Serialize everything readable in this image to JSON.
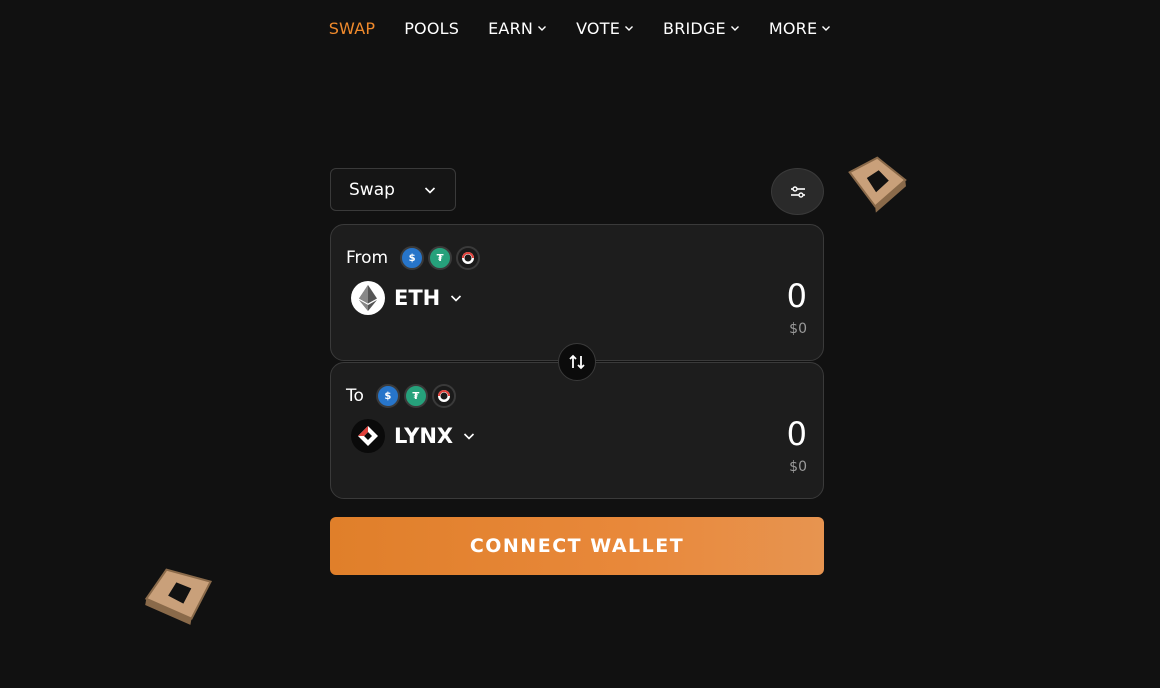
{
  "nav": {
    "items": [
      {
        "label": "SWAP",
        "active": true,
        "dropdown": false
      },
      {
        "label": "POOLS",
        "active": false,
        "dropdown": false
      },
      {
        "label": "EARN",
        "active": false,
        "dropdown": true
      },
      {
        "label": "VOTE",
        "active": false,
        "dropdown": true
      },
      {
        "label": "BRIDGE",
        "active": false,
        "dropdown": true
      },
      {
        "label": "MORE",
        "active": false,
        "dropdown": true
      }
    ]
  },
  "mode_select": {
    "label": "Swap"
  },
  "from": {
    "label": "From",
    "token": "ETH",
    "amount": "0",
    "usd": "$0",
    "quick_tokens": [
      "usdc-icon",
      "usdt-icon",
      "wbtc-icon"
    ]
  },
  "to": {
    "label": "To",
    "token": "LYNX",
    "amount": "0",
    "usd": "$0",
    "quick_tokens": [
      "usdc-icon",
      "usdt-icon",
      "wbtc-icon"
    ]
  },
  "connect": {
    "label": "CONNECT WALLET"
  },
  "colors": {
    "accent": "#f08a2c",
    "background": "#111111",
    "panel": "#1d1d1d",
    "usdc": "#2775ca",
    "usdt": "#26a17b"
  }
}
